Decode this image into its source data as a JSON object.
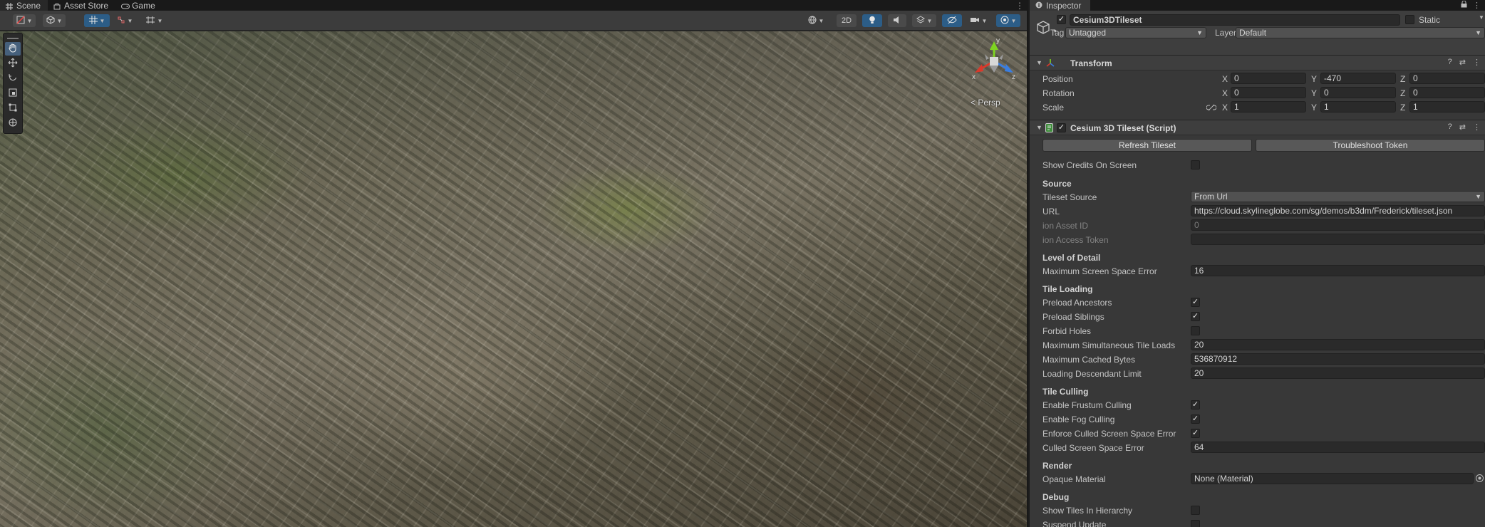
{
  "scene_tabs": [
    {
      "label": "Scene",
      "icon": "hash-icon"
    },
    {
      "label": "Asset Store",
      "icon": "bag-icon"
    },
    {
      "label": "Game",
      "icon": "gamepad-icon"
    }
  ],
  "scene_toolbar": {
    "mode_2d_label": "2D"
  },
  "viewport": {
    "gizmo_axes": {
      "x": "x",
      "y": "y",
      "z": "z"
    },
    "projection_label": "< Persp"
  },
  "inspector_tab": {
    "label": "Inspector"
  },
  "gameobject": {
    "active": true,
    "name": "Cesium3DTileset",
    "static_label": "Static",
    "tag_label": "Tag",
    "tag_value": "Untagged",
    "layer_label": "Layer",
    "layer_value": "Default"
  },
  "transform": {
    "title": "Transform",
    "rows": [
      {
        "label": "Position",
        "x": "0",
        "y": "-470",
        "z": "0"
      },
      {
        "label": "Rotation",
        "x": "0",
        "y": "0",
        "z": "0"
      },
      {
        "label": "Scale",
        "x": "1",
        "y": "1",
        "z": "1"
      }
    ],
    "axis_labels": {
      "x": "X",
      "y": "Y",
      "z": "Z"
    }
  },
  "tileset_script": {
    "title": "Cesium 3D Tileset (Script)",
    "refresh_button": "Refresh Tileset",
    "troubleshoot_button": "Troubleshoot Token",
    "show_credits": {
      "label": "Show Credits On Screen",
      "checked": false
    },
    "source_heading": "Source",
    "tileset_source": {
      "label": "Tileset Source",
      "value": "From Url"
    },
    "url": {
      "label": "URL",
      "value": "https://cloud.skylineglobe.com/sg/demos/b3dm/Frederick/tileset.json"
    },
    "ion_asset_id": {
      "label": "ion Asset ID",
      "value": "0"
    },
    "ion_access_token": {
      "label": "ion Access Token",
      "value": ""
    },
    "lod_heading": "Level of Detail",
    "max_sse": {
      "label": "Maximum Screen Space Error",
      "value": "16"
    },
    "tile_loading_heading": "Tile Loading",
    "preload_ancestors": {
      "label": "Preload Ancestors",
      "checked": true
    },
    "preload_siblings": {
      "label": "Preload Siblings",
      "checked": true
    },
    "forbid_holes": {
      "label": "Forbid Holes",
      "checked": false
    },
    "max_sim_loads": {
      "label": "Maximum Simultaneous Tile Loads",
      "value": "20"
    },
    "max_cached_bytes": {
      "label": "Maximum Cached Bytes",
      "value": "536870912"
    },
    "loading_desc_limit": {
      "label": "Loading Descendant Limit",
      "value": "20"
    },
    "tile_culling_heading": "Tile Culling",
    "frustum_culling": {
      "label": "Enable Frustum Culling",
      "checked": true
    },
    "fog_culling": {
      "label": "Enable Fog Culling",
      "checked": true
    },
    "enforce_culled_sse": {
      "label": "Enforce Culled Screen Space Error",
      "checked": true
    },
    "culled_sse": {
      "label": "Culled Screen Space Error",
      "value": "64"
    },
    "render_heading": "Render",
    "opaque_material": {
      "label": "Opaque Material",
      "value": "None (Material)"
    },
    "debug_heading": "Debug",
    "show_tiles_hierarchy": {
      "label": "Show Tiles In Hierarchy",
      "checked": false
    },
    "suspend_update": {
      "label": "Suspend Update",
      "checked": false
    }
  },
  "colors": {
    "panel_bg": "#383838",
    "header_bg": "#3e3e3e",
    "field_bg": "#2a2a2a",
    "toolbar_accent": "#2c5d87",
    "gizmo_x": "#d8392b",
    "gizmo_y": "#7ed321",
    "gizmo_z": "#3a7ee0"
  }
}
